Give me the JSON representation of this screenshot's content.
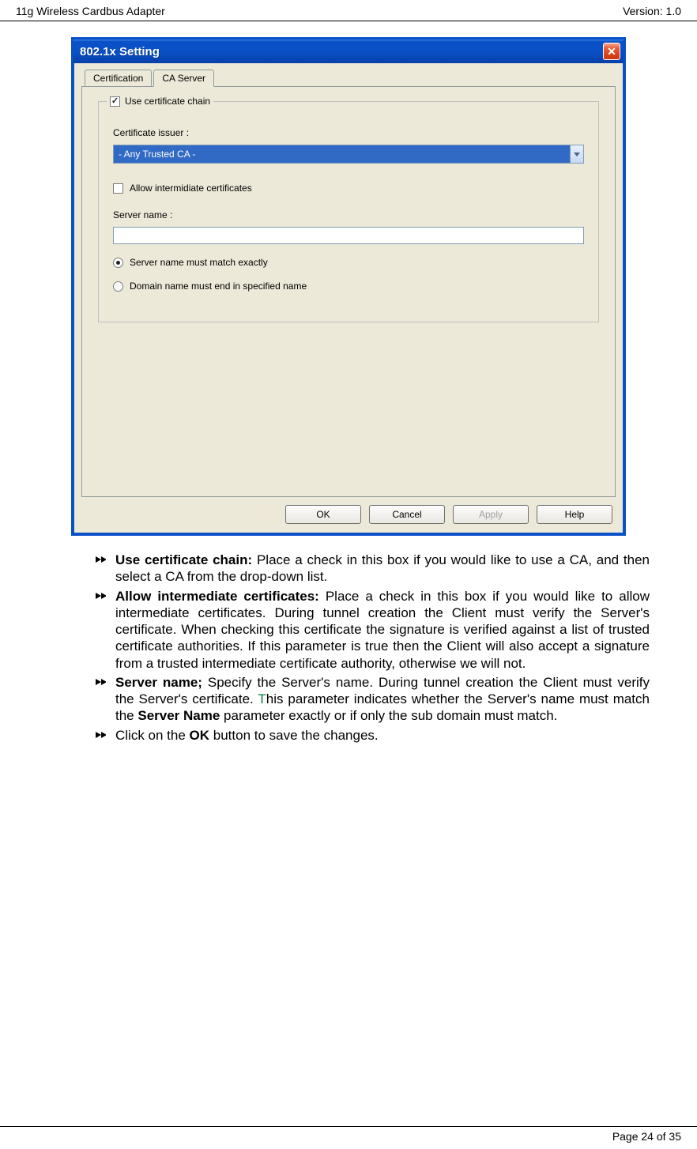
{
  "header": {
    "left": "11g Wireless Cardbus Adapter",
    "right": "Version: 1.0"
  },
  "dialog": {
    "title": "802.1x Setting",
    "tabs": [
      {
        "label": "Certification",
        "active": false
      },
      {
        "label": "CA Server",
        "active": true
      }
    ],
    "group_legend": "Use certificate chain",
    "cert_issuer_label": "Certificate issuer :",
    "cert_issuer_value": "- Any Trusted CA -",
    "allow_intermediate_label": "Allow intermidiate certificates",
    "server_name_label": "Server name :",
    "server_name_value": "",
    "radio_exact": "Server name must match exactly",
    "radio_domain": "Domain name must end in specified name",
    "buttons": {
      "ok": "OK",
      "cancel": "Cancel",
      "apply": "Apply",
      "help": "Help"
    }
  },
  "bullets": [
    {
      "bold": "Use certificate chain:",
      "rest": " Place a check in this box if you would like to use a CA, and then select a CA from the drop-down list."
    },
    {
      "bold": "Allow intermediate certificates:",
      "rest": " Place a check in this box if you would like to allow intermediate certificates. During tunnel creation the Client must verify the Server's certificate. When checking this certificate the signature is verified against a list of trusted certificate authorities. If this parameter is true then the Client will also accept a signature from a trusted intermediate certificate authority, otherwise we will not."
    },
    {
      "bold": "Server name;",
      "rest_pre": " Specify the Server's name. During tunnel creation the Client must verify the Server's certificate. ",
      "green": "T",
      "rest_post": "his parameter indicates whether the Server's name must match the ",
      "bold2": "Server Name",
      "rest_post2": " parameter exactly or if only the sub domain must match."
    },
    {
      "plain_pre": "Click on the ",
      "bold": "OK",
      "plain_post": " button to save the changes."
    }
  ],
  "footer": "Page 24 of 35"
}
